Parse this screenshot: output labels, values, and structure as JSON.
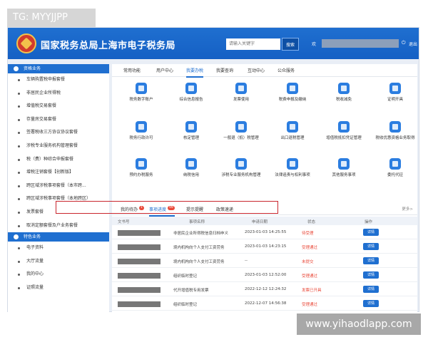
{
  "overlay_tag": "TG: MYYJJPP",
  "watermark": "www.yihaodlapp.com",
  "header": {
    "title": "国家税务总局上海市电子税务局",
    "search_placeholder": "请输入关键字",
    "search_button": "搜索",
    "welcome": "欢",
    "exit": "退出"
  },
  "sidebar": {
    "section1": "资格业务",
    "items1": [
      "车辆购置税申报套餐",
      "非居民企业所得税",
      "增值税交易套餐",
      "存量房交易套餐",
      "签署税收三方协议协议套餐",
      "涉税专业服务机构管理套餐",
      "税（费）种综合申报套餐",
      "增税注销套餐【创新版】",
      "跨区域涉税事项套餐（本市跨...",
      "跨区域涉税事项套餐（本地跨区）",
      "发票套餐",
      "取消定额套餐及户业务套餐"
    ],
    "section2": "特色业务",
    "items2": [
      "电子资料",
      "大厅流量",
      "我的中心",
      "证照流量"
    ]
  },
  "tabs": [
    "常用功能",
    "用户中心",
    "我要办税",
    "我要查询",
    "互动中心",
    "公众服务"
  ],
  "functions": [
    "税务数字账户",
    "综合信息报告",
    "发票使用",
    "税费申报及缴纳",
    "税收减免",
    "证明开具",
    "税务行政许可",
    "核定管理",
    "一般退（抵）税管理",
    "出口退税管理",
    "增值税抵扣凭证管理",
    "税收优惠资格业务取得",
    "预约办税服务",
    "纳税信用",
    "涉税专业服务机构管理",
    "法律追责与权利事项",
    "其他服务事项",
    "委托代征"
  ],
  "task_tabs": {
    "todo": "我的待办",
    "todo_count": "1",
    "progress": "事项进度",
    "progress_count": "99",
    "reminder": "提示提醒",
    "policy": "政策速递",
    "more": "更多>"
  },
  "table": {
    "headers": [
      "文书号",
      "事项名称",
      "申请日期",
      "状态",
      "操作"
    ],
    "rows": [
      {
        "name": "非居民企业所得税信息归档申义",
        "date": "2023-01-03 14:25:55",
        "status": "待受理",
        "action": "详情"
      },
      {
        "name": "境内机构向个人支付工资劳务",
        "date": "2023-01-03 14:23:15",
        "status": "受理通过",
        "action": "详情"
      },
      {
        "name": "境内机构向个人支付工资劳务",
        "date": "--",
        "status": "未提交",
        "action": "详情"
      },
      {
        "name": "组织临时登记",
        "date": "2023-01-03 12:52:00",
        "status": "受理通过",
        "action": "详情"
      },
      {
        "name": "代开增值税专用发票",
        "date": "2022-12-12 12:24:32",
        "status": "发票已开具",
        "action": "详情"
      },
      {
        "name": "组织临时登记",
        "date": "2022-12-07 14:56:38",
        "status": "受理通过",
        "action": "详情"
      }
    ]
  }
}
